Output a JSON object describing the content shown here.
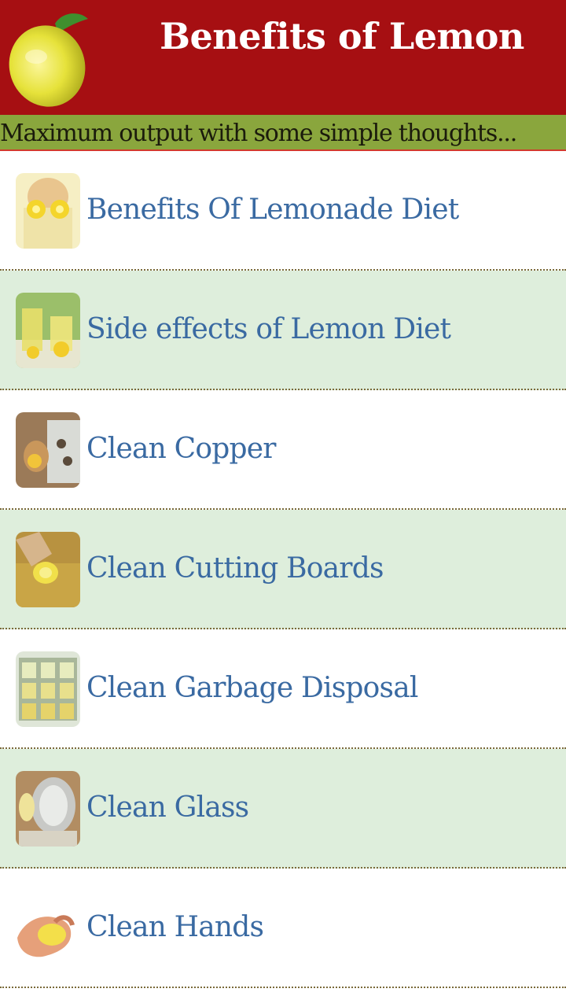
{
  "header": {
    "title": "Benefits of Lemon",
    "tagline": "Maximum output with some simple thoughts...",
    "logo_icon": "lemon-icon"
  },
  "colors": {
    "header_bg": "#a60f12",
    "tagline_bg": "#8aa63d",
    "item_text": "#3a6aa2",
    "alt_row_bg": "#deeedc"
  },
  "list": {
    "items": [
      {
        "label": "Benefits Of Lemonade Diet",
        "thumb": "lemon-eyes-photo"
      },
      {
        "label": "Side effects of Lemon Diet",
        "thumb": "lemonade-glasses-photo"
      },
      {
        "label": "Clean Copper",
        "thumb": "copper-cleaning-photo"
      },
      {
        "label": "Clean Cutting Boards",
        "thumb": "cutting-board-photo"
      },
      {
        "label": "Clean Garbage Disposal",
        "thumb": "ice-tray-photo"
      },
      {
        "label": "Clean Glass",
        "thumb": "glass-cleaning-photo"
      },
      {
        "label": "Clean Hands",
        "thumb": "hands-lemon-photo"
      }
    ]
  }
}
